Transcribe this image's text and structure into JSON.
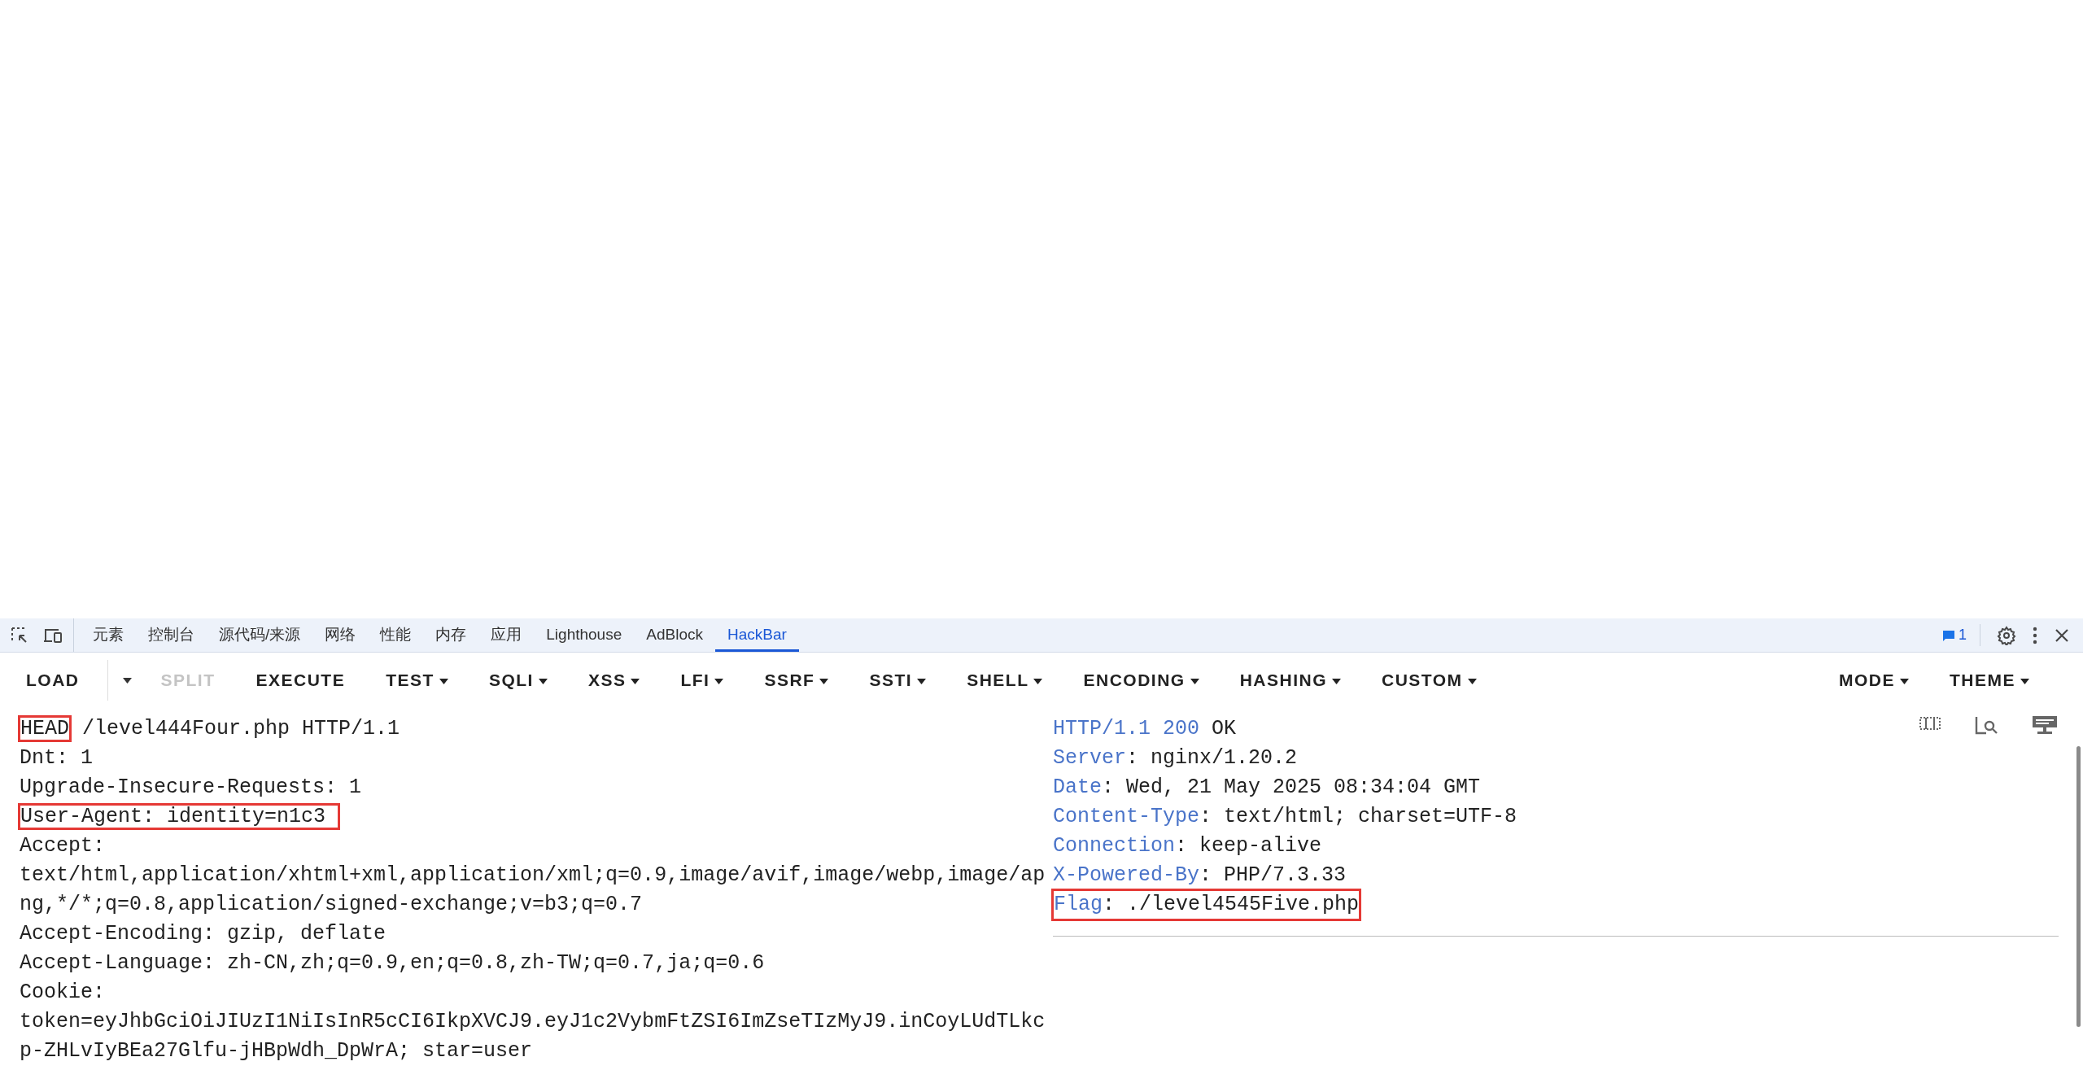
{
  "devtools_tabs": [
    {
      "label": "元素",
      "selected": false
    },
    {
      "label": "控制台",
      "selected": false
    },
    {
      "label": "源代码/来源",
      "selected": false
    },
    {
      "label": "网络",
      "selected": false
    },
    {
      "label": "性能",
      "selected": false
    },
    {
      "label": "内存",
      "selected": false
    },
    {
      "label": "应用",
      "selected": false
    },
    {
      "label": "Lighthouse",
      "selected": false
    },
    {
      "label": "AdBlock",
      "selected": false
    },
    {
      "label": "HackBar",
      "selected": true
    }
  ],
  "issues_count": "1",
  "toolbar_left": [
    {
      "label": "LOAD",
      "dropdown": false,
      "disabled": false
    },
    {
      "dropdown": true,
      "kind": "split-caret"
    },
    {
      "label": "SPLIT",
      "dropdown": false,
      "disabled": true
    },
    {
      "label": "EXECUTE",
      "dropdown": false,
      "disabled": false
    },
    {
      "label": "TEST",
      "dropdown": true,
      "disabled": false
    },
    {
      "label": "SQLI",
      "dropdown": true,
      "disabled": false
    },
    {
      "label": "XSS",
      "dropdown": true,
      "disabled": false
    },
    {
      "label": "LFI",
      "dropdown": true,
      "disabled": false
    },
    {
      "label": "SSRF",
      "dropdown": true,
      "disabled": false
    },
    {
      "label": "SSTI",
      "dropdown": true,
      "disabled": false
    },
    {
      "label": "SHELL",
      "dropdown": true,
      "disabled": false
    },
    {
      "label": "ENCODING",
      "dropdown": true,
      "disabled": false
    },
    {
      "label": "HASHING",
      "dropdown": true,
      "disabled": false
    },
    {
      "label": "CUSTOM",
      "dropdown": true,
      "disabled": false
    }
  ],
  "toolbar_right": [
    {
      "label": "MODE",
      "dropdown": true,
      "disabled": false
    },
    {
      "label": "THEME",
      "dropdown": true,
      "disabled": false
    }
  ],
  "request_lines": [
    [
      {
        "text": "HEAD",
        "boxed": true
      },
      {
        "text": " /level444Four.php HTTP/1.1",
        "boxed": false
      }
    ],
    [
      {
        "text": "Dnt: 1",
        "boxed": false
      }
    ],
    [
      {
        "text": "Upgrade-Insecure-Requests: 1",
        "boxed": false
      }
    ],
    [
      {
        "text": "User-Agent: identity=n1c3 ",
        "boxed": true
      }
    ],
    [
      {
        "text": "Accept:",
        "boxed": false
      }
    ],
    [
      {
        "text": "text/html,application/xhtml+xml,application/xml;q=0.9,image/avif,image/webp,image/ap",
        "boxed": false
      }
    ],
    [
      {
        "text": "ng,*/*;q=0.8,application/signed-exchange;v=b3;q=0.7",
        "boxed": false
      }
    ],
    [
      {
        "text": "Accept-Encoding: gzip, deflate",
        "boxed": false
      }
    ],
    [
      {
        "text": "Accept-Language: zh-CN,zh;q=0.9,en;q=0.8,zh-TW;q=0.7,ja;q=0.6",
        "boxed": false
      }
    ],
    [
      {
        "text": "Cookie:",
        "boxed": false
      }
    ],
    [
      {
        "text": "token=eyJhbGciOiJIUzI1NiIsInR5cCI6IkpXVCJ9.eyJ1c2VybmFtZSI6ImZseTIzMyJ9.inCoyLUdTLkc",
        "boxed": false
      }
    ],
    [
      {
        "text": "p-ZHLvIyBEa27Glfu-jHBpWdh_DpWrA; star=user",
        "boxed": false
      }
    ]
  ],
  "response_lines": [
    {
      "boxed": false,
      "parts": [
        {
          "text": "HTTP/1.1 200",
          "kind": "key"
        },
        {
          "text": " OK",
          "kind": "plain"
        }
      ]
    },
    {
      "boxed": false,
      "parts": [
        {
          "text": "Server",
          "kind": "key"
        },
        {
          "text": ": nginx/1.20.2",
          "kind": "plain"
        }
      ]
    },
    {
      "boxed": false,
      "parts": [
        {
          "text": "Date",
          "kind": "key"
        },
        {
          "text": ": Wed, 21 May 2025 08:34:04 GMT",
          "kind": "plain"
        }
      ]
    },
    {
      "boxed": false,
      "parts": [
        {
          "text": "Content-Type",
          "kind": "key"
        },
        {
          "text": ": text/html; charset=UTF-8",
          "kind": "plain"
        }
      ]
    },
    {
      "boxed": false,
      "parts": [
        {
          "text": "Connection",
          "kind": "key"
        },
        {
          "text": ": keep-alive",
          "kind": "plain"
        }
      ]
    },
    {
      "boxed": false,
      "parts": [
        {
          "text": "X-Powered-By",
          "kind": "key"
        },
        {
          "text": ": PHP/7.3.33",
          "kind": "plain"
        }
      ]
    },
    {
      "boxed": true,
      "parts": [
        {
          "text": "Flag",
          "kind": "key"
        },
        {
          "text": ": ./level4545Five.php",
          "kind": "plain"
        }
      ]
    }
  ]
}
